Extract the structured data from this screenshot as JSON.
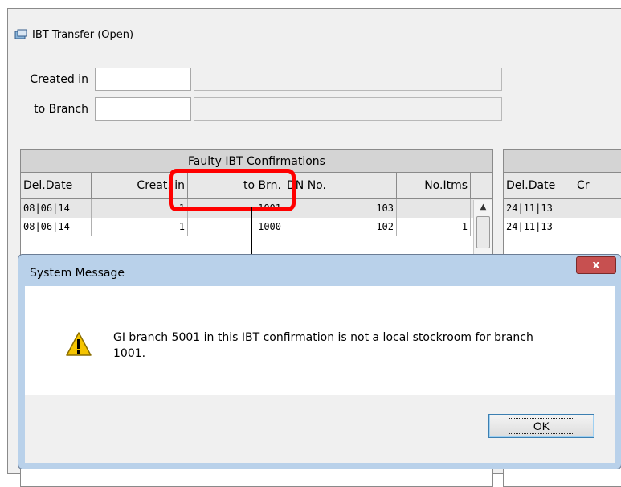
{
  "window": {
    "title": "IBT Transfer (Open)",
    "icon": "ibt-window-icon"
  },
  "filters": {
    "created_in_label": "Created in",
    "to_branch_label": "to Branch",
    "created_in_value": "",
    "created_in_desc": "",
    "to_branch_value": "",
    "to_branch_desc": ""
  },
  "grid": {
    "caption": "Faulty IBT Confirmations",
    "columns": [
      "Del.Date",
      "Creat. in",
      "to Brn.",
      "DN No.",
      "No.Itms"
    ],
    "rows": [
      [
        "08|06|14",
        "1",
        "1001",
        "103",
        ""
      ],
      [
        "08|06|14",
        "1",
        "1000",
        "102",
        "1"
      ]
    ]
  },
  "grid2": {
    "columns": [
      "Del.Date",
      "Cr"
    ],
    "rows": [
      [
        "24|11|13"
      ],
      [
        "24|11|13"
      ]
    ]
  },
  "dialog": {
    "title": "System Message",
    "close_label": "x",
    "message": "GI branch 5001 in this IBT confirmation is not a local stockroom for branch 1001.",
    "ok_label": "OK",
    "icon": "warning-icon"
  },
  "colors": {
    "highlight": "#ff0000",
    "dialog_frame": "#b9d1ea",
    "close_button": "#c75050"
  }
}
